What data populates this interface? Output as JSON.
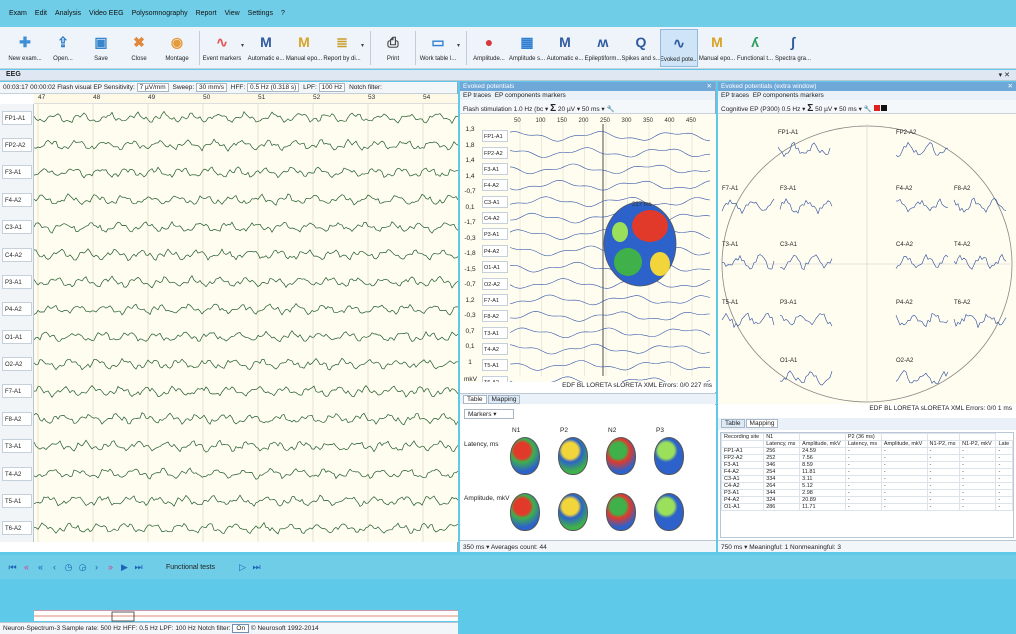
{
  "menu": [
    "Exam",
    "Edit",
    "Analysis",
    "Video EEG",
    "Polysomnography",
    "Report",
    "View",
    "Settings",
    "?"
  ],
  "toolbar": [
    {
      "label": "New exam...",
      "icon": "new-exam-icon",
      "color": "#3d8fd4",
      "glyph": "✚"
    },
    {
      "label": "Open...",
      "icon": "open-icon",
      "color": "#2e7cc8",
      "glyph": "⇪"
    },
    {
      "label": "Save",
      "icon": "save-icon",
      "color": "#3a86cc",
      "glyph": "▣"
    },
    {
      "label": "Close",
      "icon": "close-exam-icon",
      "color": "#e0873a",
      "glyph": "✖"
    },
    {
      "label": "Montage",
      "icon": "montage-icon",
      "color": "#e59b3b",
      "glyph": "◉"
    },
    {
      "label": "Event markers",
      "icon": "event-markers-icon",
      "color": "#e25656",
      "glyph": "∿"
    },
    {
      "label": "Automatic e...",
      "icon": "automatic-epochs-icon",
      "color": "#2f5aa0",
      "glyph": "M"
    },
    {
      "label": "Manual epo...",
      "icon": "manual-epochs-icon",
      "color": "#d9a326",
      "glyph": "M"
    },
    {
      "label": "Report by di...",
      "icon": "report-icon",
      "color": "#c99d2b",
      "glyph": "≣"
    },
    {
      "label": "Print",
      "icon": "print-icon",
      "color": "#444444",
      "glyph": "⎙"
    },
    {
      "label": "Work table l...",
      "icon": "work-table-icon",
      "color": "#2f7ed1",
      "glyph": "▭"
    },
    {
      "label": "Amplitude...",
      "icon": "amplitude-map-icon",
      "color": "#d63a3a",
      "glyph": "●"
    },
    {
      "label": "Amplitude s...",
      "icon": "amplitude-spectra-icon",
      "color": "#2f7ed1",
      "glyph": "▦"
    },
    {
      "label": "Automatic e...",
      "icon": "automatic-epileptiform-icon",
      "color": "#2f5aa0",
      "glyph": "M"
    },
    {
      "label": "Epileptiform...",
      "icon": "epileptiform-icon",
      "color": "#2f5aa0",
      "glyph": "ʍ"
    },
    {
      "label": "Spikes and s...",
      "icon": "spikes-icon",
      "color": "#2f5aa0",
      "glyph": "Q"
    },
    {
      "label": "Evoked pote...",
      "icon": "evoked-potentials-icon",
      "color": "#2f5aa0",
      "glyph": "∿",
      "selected": true
    },
    {
      "label": "Manual epo...",
      "icon": "manual-epochs-2-icon",
      "color": "#d9a326",
      "glyph": "M"
    },
    {
      "label": "Functional t...",
      "icon": "functional-tests-icon",
      "color": "#2a9d5a",
      "glyph": "ʎ"
    },
    {
      "label": "Spectra gra...",
      "icon": "spectra-graph-icon",
      "color": "#2f5aa0",
      "glyph": "∫"
    }
  ],
  "eeg": {
    "title": "EEG",
    "info": "00:03:17   00:00:02  Flash visual EP   Sensitivity:",
    "sensitivity": "7 µV/mm",
    "sweep_label": "Sweep:",
    "sweep": "30 mm/s",
    "hff_label": "HFF:",
    "hff": "0.5 Hz (0.318 s)",
    "lpf_label": "LPF:",
    "lpf": "100 Hz",
    "notch": "Notch filter:",
    "ticks": [
      "47",
      "48",
      "49",
      "50",
      "51",
      "52",
      "53",
      "54"
    ],
    "channels": [
      "FP1-A1",
      "FP2-A2",
      "F3-A1",
      "F4-A2",
      "C3-A1",
      "C4-A2",
      "P3-A1",
      "P4-A2",
      "O1-A1",
      "O2-A2",
      "F7-A1",
      "F8-A2",
      "T3-A1",
      "T4-A2",
      "T5-A1",
      "T6-A2"
    ],
    "status": "Neuron-Spectrum-3   Sample rate: 500 Hz   HFF: 0.5 Hz   LPF: 100 Hz   Notch filter:",
    "notch_state": "On",
    "copyright": "© Neurosoft 1992-2014"
  },
  "ep": {
    "title": "Evoked potentials",
    "tabs": [
      "EP traces",
      "EP components markers"
    ],
    "stimulation": "Flash stimulation 1.0 Hz (bc ▾",
    "amp": "20 µV",
    "time": "50 ms",
    "ms_ticks": [
      "50",
      "100",
      "150",
      "200",
      "250",
      "300",
      "350",
      "400",
      "450"
    ],
    "values": [
      "1,3",
      "1,8",
      "1,4",
      "1,4",
      "-0,7",
      "0,1",
      "-1,7",
      "-0,3",
      "-1,8",
      "-1,5",
      "-0,7",
      "1,2",
      "-0,3",
      "0,7",
      "0,1",
      "1"
    ],
    "unit": "mkV",
    "channels": [
      "FP1-A1",
      "FP2-A2",
      "F3-A1",
      "F4-A2",
      "C3-A1",
      "C4-A2",
      "P3-A1",
      "P4-A2",
      "O1-A1",
      "O2-A2",
      "F7-A1",
      "F8-A2",
      "T3-A1",
      "T4-A2",
      "T5-A1",
      "T6-A2"
    ],
    "latency_note": "227 ms",
    "footer": "EDF  BL  LORETA  sLORETA  XML   Errors: 0/0  227 ms",
    "bottom_tabs": [
      "Table",
      "Mapping"
    ],
    "markers_label": "Markers",
    "components": [
      "N1",
      "P2",
      "N2",
      "P3"
    ],
    "rows": [
      "Latency, ms",
      "Amplitude, mkV"
    ],
    "status": "350 ms ▾   Averages count: 44"
  },
  "ep2": {
    "title": "Evoked potentials (extra window)",
    "tabs": [
      "EP traces",
      "EP components markers"
    ],
    "stimulation": "Cognitive EP (P300) 0.5 Hz ▾",
    "amp": "50 µV",
    "time": "50 ms",
    "sites": [
      "FP1-A1",
      "FP2-A2",
      "F7-A1",
      "F3-A1",
      "F4-A2",
      "F8-A2",
      "T3-A1",
      "C3-A1",
      "C4-A2",
      "T4-A2",
      "T5-A1",
      "P3-A1",
      "P4-A2",
      "T6-A2",
      "O1-A1",
      "O2-A2"
    ],
    "footer": "EDF  BL  LORETA  sLORETA  XML   Errors: 0/0  1 ms",
    "bottom_tabs": [
      "Table",
      "Mapping"
    ],
    "table": {
      "h1": [
        "Recording site",
        "N1",
        "",
        "P2 (36 ms)",
        "",
        "",
        ""
      ],
      "h2": [
        "",
        "Latency, ms",
        "Amplitude, mkV",
        "Latency, ms",
        "Amplitude, mkV",
        "N1-P2, ms",
        "N1-P2, mkV",
        "Late"
      ],
      "rows": [
        [
          "FP1-A1",
          "256",
          "24.59",
          "-",
          "-",
          "-",
          "-",
          "-"
        ],
        [
          "FP2-A2",
          "252",
          "7.56",
          "-",
          "-",
          "-",
          "-",
          "-"
        ],
        [
          "F3-A1",
          "346",
          "8.59",
          "-",
          "-",
          "-",
          "-",
          "-"
        ],
        [
          "F4-A2",
          "254",
          "11.81",
          "-",
          "-",
          "-",
          "-",
          "-"
        ],
        [
          "C3-A1",
          "334",
          "3.11",
          "-",
          "-",
          "-",
          "-",
          "-"
        ],
        [
          "C4-A2",
          "264",
          "5.12",
          "-",
          "-",
          "-",
          "-",
          "-"
        ],
        [
          "P3-A1",
          "344",
          "2.98",
          "-",
          "-",
          "-",
          "-",
          "-"
        ],
        [
          "P4-A2",
          "324",
          "20.89",
          "-",
          "-",
          "-",
          "-",
          "-"
        ],
        [
          "O1-A1",
          "286",
          "11.71",
          "-",
          "-",
          "-",
          "-",
          "-"
        ]
      ]
    },
    "status": "750 ms ▾   Meaningful: 1  Nonmeaningful: 3"
  },
  "taskbar": {
    "label": "Functional tests"
  }
}
